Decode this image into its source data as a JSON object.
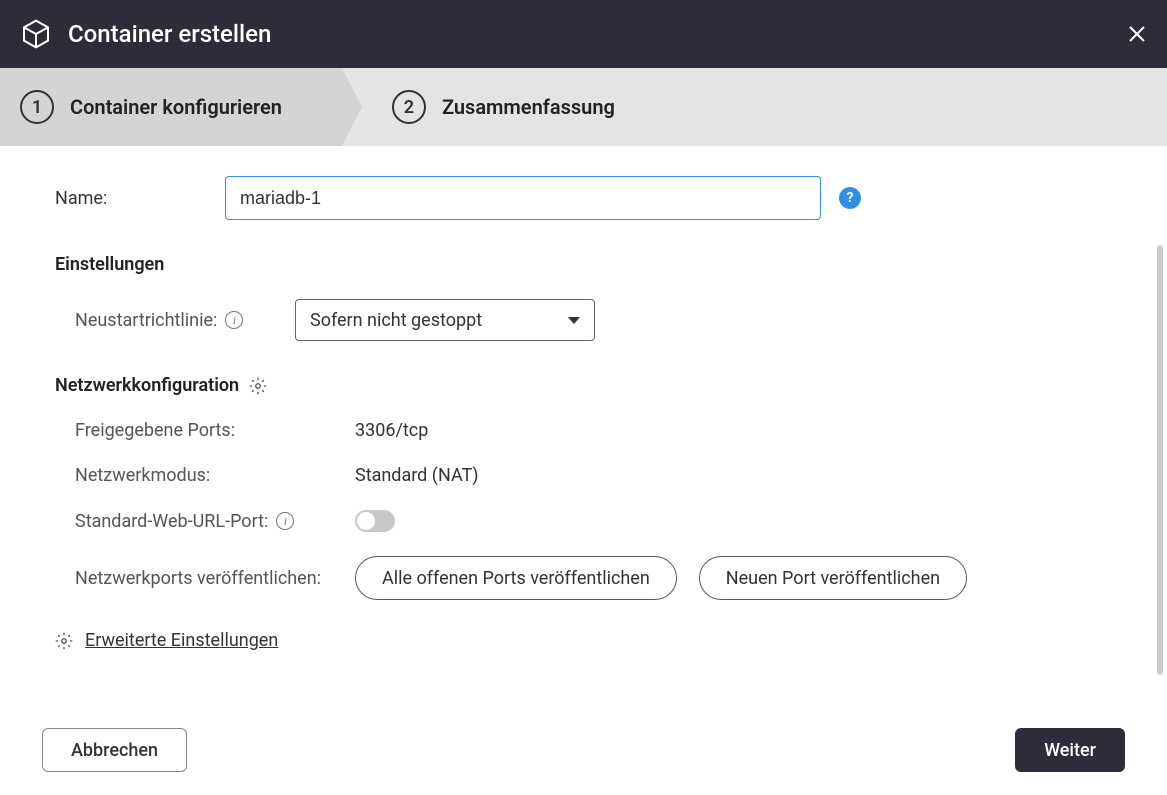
{
  "header": {
    "title": "Container erstellen"
  },
  "steps": [
    {
      "num": "1",
      "label": "Container konfigurieren"
    },
    {
      "num": "2",
      "label": "Zusammenfassung"
    }
  ],
  "form": {
    "name_label": "Name:",
    "name_value": "mariadb-1",
    "settings_header": "Einstellungen",
    "restart_policy_label": "Neustartrichtlinie:",
    "restart_policy_value": "Sofern nicht gestoppt",
    "network_header": "Netzwerkkonfiguration",
    "exposed_ports_label": "Freigegebene Ports:",
    "exposed_ports_value": "3306/tcp",
    "network_mode_label": "Netzwerkmodus:",
    "network_mode_value": "Standard (NAT)",
    "web_url_port_label": "Standard-Web-URL-Port:",
    "publish_ports_label": "Netzwerkports veröffentlichen:",
    "publish_all_btn": "Alle offenen Ports veröffentlichen",
    "publish_new_btn": "Neuen Port veröffentlichen",
    "advanced_link": "Erweiterte Einstellungen"
  },
  "footer": {
    "cancel": "Abbrechen",
    "next": "Weiter"
  }
}
